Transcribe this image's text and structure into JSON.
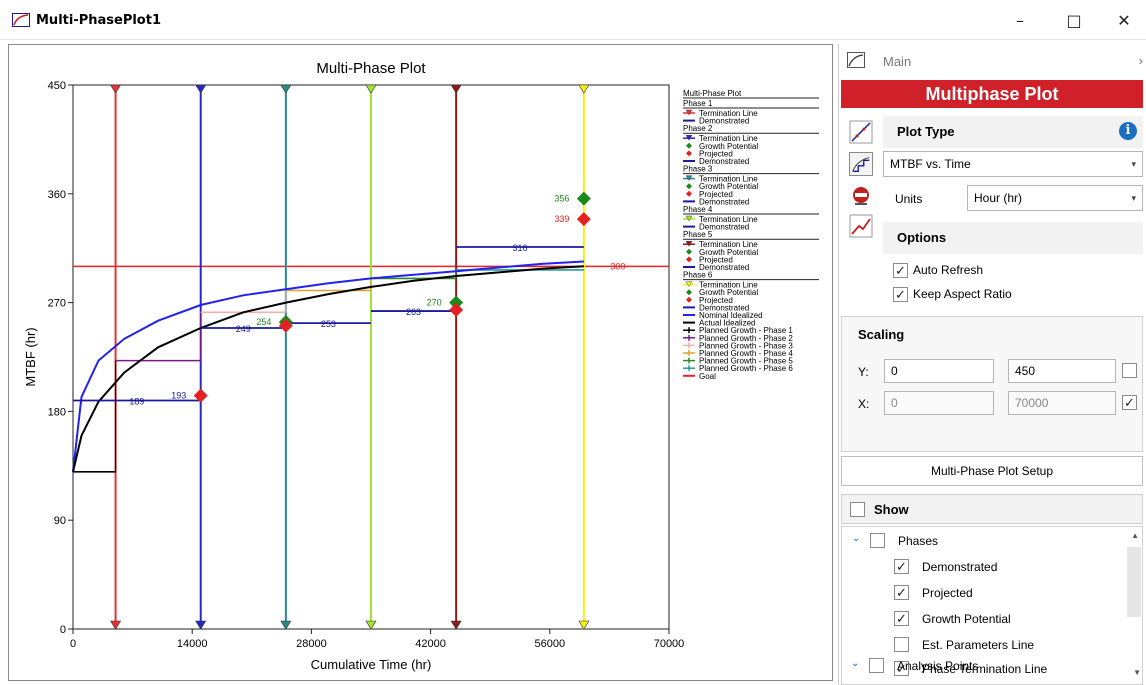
{
  "window": {
    "title": "Multi-PhasePlot1",
    "minimize": "–",
    "maximize": "□",
    "close": "✕"
  },
  "chart_data": {
    "type": "line",
    "title": "Multi-Phase Plot",
    "xlabel": "Cumulative Time (hr)",
    "ylabel": "MTBF (hr)",
    "xlim": [
      0,
      70000
    ],
    "ylim": [
      0,
      450
    ],
    "x_ticks": [
      "0",
      "14000",
      "28000",
      "42000",
      "56000",
      "70000"
    ],
    "y_ticks": [
      "0",
      "90",
      "180",
      "270",
      "360",
      "450"
    ],
    "goal": 300,
    "goal_label": "300",
    "phase_terminations": [
      {
        "x": 5000,
        "color": "#e53333"
      },
      {
        "x": 15000,
        "color": "#2828c8"
      },
      {
        "x": 25000,
        "color": "#2a8a8a"
      },
      {
        "x": 35000,
        "color": "#9ee62e"
      },
      {
        "x": 45000,
        "color": "#8b1a1a"
      },
      {
        "x": 60000,
        "color": "#f2f21a"
      }
    ],
    "demonstrated": [
      {
        "x0": 0,
        "x1": 15000,
        "y": 189,
        "label": "189"
      },
      {
        "x0": 15000,
        "x1": 25000,
        "y": 249,
        "label": "249"
      },
      {
        "x0": 25000,
        "x1": 35000,
        "y": 253,
        "label": "253"
      },
      {
        "x0": 35000,
        "x1": 45000,
        "y": 263,
        "label": "263"
      },
      {
        "x0": 45000,
        "x1": 60000,
        "y": 316,
        "label": "316"
      }
    ],
    "projected": [
      {
        "x": 15000,
        "y": 193,
        "label": "193"
      },
      {
        "x": 25000,
        "y": 251,
        "label": ""
      },
      {
        "x": 45000,
        "y": 264,
        "label": ""
      },
      {
        "x": 60000,
        "y": 339,
        "label": "339"
      }
    ],
    "growth_potential": [
      {
        "x": 25000,
        "y": 254,
        "label": "254"
      },
      {
        "x": 45000,
        "y": 270,
        "label": "270"
      },
      {
        "x": 60000,
        "y": 356,
        "label": "356"
      }
    ],
    "planned_growth": [
      {
        "x0": 0,
        "x1": 5000,
        "y": 130,
        "color": "#000000"
      },
      {
        "x0": 5000,
        "x1": 15000,
        "y": 222,
        "color": "#7a1a8a"
      },
      {
        "x0": 15000,
        "x1": 25000,
        "y": 262,
        "color": "#f0b0b0"
      },
      {
        "x0": 25000,
        "x1": 35000,
        "y": 280,
        "color": "#e0a030"
      },
      {
        "x0": 35000,
        "x1": 45000,
        "y": 290,
        "color": "#2a8a2a"
      },
      {
        "x0": 45000,
        "x1": 60000,
        "y": 297,
        "color": "#2a9a9a"
      }
    ],
    "nominal_idealized": [
      [
        0,
        130
      ],
      [
        1000,
        192
      ],
      [
        3000,
        222
      ],
      [
        6000,
        240
      ],
      [
        10000,
        255
      ],
      [
        15000,
        268
      ],
      [
        20000,
        276
      ],
      [
        25000,
        281
      ],
      [
        30000,
        286
      ],
      [
        35000,
        290
      ],
      [
        40000,
        293
      ],
      [
        45000,
        296
      ],
      [
        50000,
        299
      ],
      [
        55000,
        302
      ],
      [
        60000,
        304
      ]
    ],
    "actual_idealized": [
      [
        0,
        130
      ],
      [
        1000,
        160
      ],
      [
        3000,
        188
      ],
      [
        6000,
        212
      ],
      [
        10000,
        233
      ],
      [
        15000,
        249
      ],
      [
        20000,
        262
      ],
      [
        25000,
        270
      ],
      [
        30000,
        277
      ],
      [
        35000,
        283
      ],
      [
        40000,
        288
      ],
      [
        45000,
        292
      ],
      [
        50000,
        295
      ],
      [
        55000,
        298
      ],
      [
        60000,
        300
      ]
    ],
    "legend": [
      {
        "text": "Multi-Phase Plot",
        "kind": "header"
      },
      {
        "text": "Phase 1",
        "kind": "group"
      },
      {
        "text": "Termination Line",
        "kind": "term",
        "color": "#e53333"
      },
      {
        "text": "Demonstrated",
        "kind": "line",
        "color": "#1a1a9a"
      },
      {
        "text": "Phase 2",
        "kind": "group"
      },
      {
        "text": "Termination Line",
        "kind": "term",
        "color": "#2828c8"
      },
      {
        "text": "Growth Potential",
        "kind": "dot",
        "color": "#1a8a1a"
      },
      {
        "text": "Projected",
        "kind": "dot",
        "color": "#e52020"
      },
      {
        "text": "Demonstrated",
        "kind": "line",
        "color": "#1a1a9a"
      },
      {
        "text": "Phase 3",
        "kind": "group"
      },
      {
        "text": "Termination Line",
        "kind": "term",
        "color": "#2a8a8a"
      },
      {
        "text": "Growth Potential",
        "kind": "dot",
        "color": "#1a8a1a"
      },
      {
        "text": "Projected",
        "kind": "dot",
        "color": "#e52020"
      },
      {
        "text": "Demonstrated",
        "kind": "line",
        "color": "#1a1a9a"
      },
      {
        "text": "Phase 4",
        "kind": "group"
      },
      {
        "text": "Termination Line",
        "kind": "term",
        "color": "#9ee62e"
      },
      {
        "text": "Demonstrated",
        "kind": "line",
        "color": "#1a1a9a"
      },
      {
        "text": "Phase 5",
        "kind": "group"
      },
      {
        "text": "Termination Line",
        "kind": "term",
        "color": "#8b1a1a"
      },
      {
        "text": "Growth Potential",
        "kind": "dot",
        "color": "#1a8a1a"
      },
      {
        "text": "Projected",
        "kind": "dot",
        "color": "#e52020"
      },
      {
        "text": "Demonstrated",
        "kind": "line",
        "color": "#1a1a9a"
      },
      {
        "text": "Phase 6",
        "kind": "group"
      },
      {
        "text": "Termination Line",
        "kind": "term",
        "color": "#f2f21a"
      },
      {
        "text": "Growth Potential",
        "kind": "dot",
        "color": "#1a8a1a"
      },
      {
        "text": "Projected",
        "kind": "dot",
        "color": "#e52020"
      },
      {
        "text": "Demonstrated",
        "kind": "line",
        "color": "#1a1a9a"
      },
      {
        "text": "Nominal Idealized",
        "kind": "line",
        "color": "#2222ee"
      },
      {
        "text": "Actual Idealized",
        "kind": "line",
        "color": "#000000"
      },
      {
        "text": "Planned Growth - Phase 1",
        "kind": "plus",
        "color": "#000000"
      },
      {
        "text": "Planned Growth - Phase 2",
        "kind": "plus",
        "color": "#7a1a8a"
      },
      {
        "text": "Planned Growth - Phase 3",
        "kind": "plus",
        "color": "#f0b0b0"
      },
      {
        "text": "Planned Growth - Phase 4",
        "kind": "plus",
        "color": "#e0a030"
      },
      {
        "text": "Planned Growth - Phase 5",
        "kind": "plus",
        "color": "#2a8a2a"
      },
      {
        "text": "Planned Growth - Phase 6",
        "kind": "plus",
        "color": "#2a9a9a"
      },
      {
        "text": "Goal",
        "kind": "line",
        "color": "#ee2020"
      }
    ]
  },
  "panel": {
    "main_label": "Main",
    "main_chevron": "›",
    "banner": "Multiphase Plot",
    "plot_type_title": "Plot Type",
    "plot_type_value": "MTBF vs. Time",
    "units_label": "Units",
    "units_value": "Hour (hr)",
    "options_title": "Options",
    "auto_refresh": "Auto Refresh",
    "keep_aspect": "Keep Aspect Ratio",
    "scaling_title": "Scaling",
    "y_label": "Y:",
    "x_label": "X:",
    "y_min": "0",
    "y_max": "450",
    "x_min": "0",
    "x_max": "70000",
    "setup_button": "Multi-Phase Plot Setup",
    "show_title": "Show",
    "tree": {
      "phases": "Phases",
      "demonstrated": "Demonstrated",
      "projected": "Projected",
      "growth_potential": "Growth Potential",
      "est_parameters": "Est. Parameters Line",
      "phase_termination": "Phase Termination Line",
      "analysis_points": "Analysis Points"
    },
    "check": "✓",
    "dropdown_arrow": "▾",
    "tree_chevron": "⌄",
    "info": "i"
  }
}
